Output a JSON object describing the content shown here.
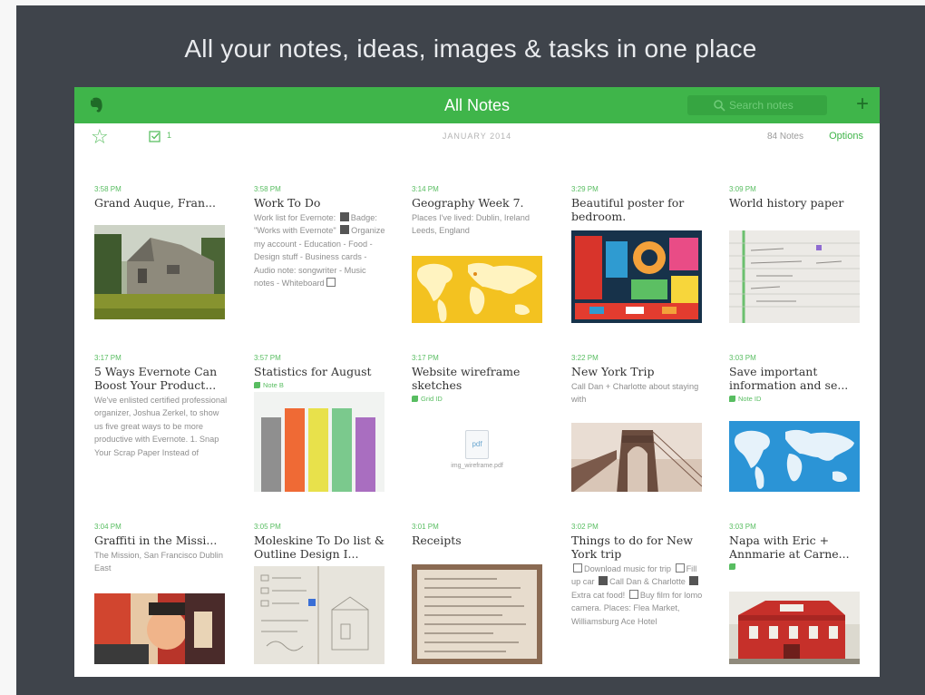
{
  "headline": "All your notes, ideas, images  & tasks in one place",
  "app": {
    "title": "All Notes",
    "search_placeholder": "Search notes",
    "add_label": "+",
    "month": "JANUARY 2014",
    "note_count": "84 Notes",
    "options_label": "Options",
    "reminder_count": "1"
  },
  "colors": {
    "brand": "#3fb54a",
    "background": "#3f444b"
  },
  "notes": [
    {
      "time": "3:58 PM",
      "title": "Grand Auque, Fran...",
      "body": ""
    },
    {
      "time": "3:58 PM",
      "title": "Work To Do",
      "body_parts": [
        "Work list for Evernote:",
        "Badge: \"Works with Evernote\"",
        "Organize my account - Education - Food - Design stuff - Business cards - Audio note: songwriter - Music notes - Whiteboard"
      ]
    },
    {
      "time": "3:14 PM",
      "title": "Geography Week 7.",
      "body": "Places I've lived: Dublin, Ireland Leeds, England"
    },
    {
      "time": "3:29 PM",
      "title": "Beautiful poster for bedroom.",
      "body": ""
    },
    {
      "time": "3:09 PM",
      "title": "World history paper",
      "body": ""
    },
    {
      "time": "3:17 PM",
      "title": "5 Ways Evernote Can Boost Your Product...",
      "body": "We've enlisted certified professional organizer, Joshua Zerkel, to show us five great ways to be more productive with Evernote. 1. Snap Your Scrap Paper Instead of"
    },
    {
      "time": "3:57 PM",
      "title": "Statistics for August",
      "tag": "Note B"
    },
    {
      "time": "3:17 PM",
      "title": "Website wireframe sketches",
      "tag": "Grid ID",
      "file_ext": "pdf",
      "file_name": "img_wireframe.pdf"
    },
    {
      "time": "3:22 PM",
      "title": "New York Trip",
      "body": "Call Dan + Charlotte about staying with"
    },
    {
      "time": "3:03 PM",
      "title": "Save important information and se...",
      "tag": "Note ID"
    },
    {
      "time": "3:04 PM",
      "title": "Graffiti in the Missi...",
      "body": "The Mission, San Francisco Dublin East"
    },
    {
      "time": "3:05 PM",
      "title": "Moleskine To Do list & Outline Design I...",
      "body": ""
    },
    {
      "time": "3:01 PM",
      "title": "Receipts",
      "body": ""
    },
    {
      "time": "3:02 PM",
      "title": "Things to do for New York trip",
      "body_parts": [
        "Download music for trip",
        "Fill up car",
        "Call Dan & Charlotte",
        "Extra cat food!",
        "Buy film for lomo camera. Places: Flea Market, Williamsburg Ace Hotel"
      ]
    },
    {
      "time": "3:03 PM",
      "title": "Napa with Eric + Annmarie at Carne...",
      "body": ""
    }
  ]
}
